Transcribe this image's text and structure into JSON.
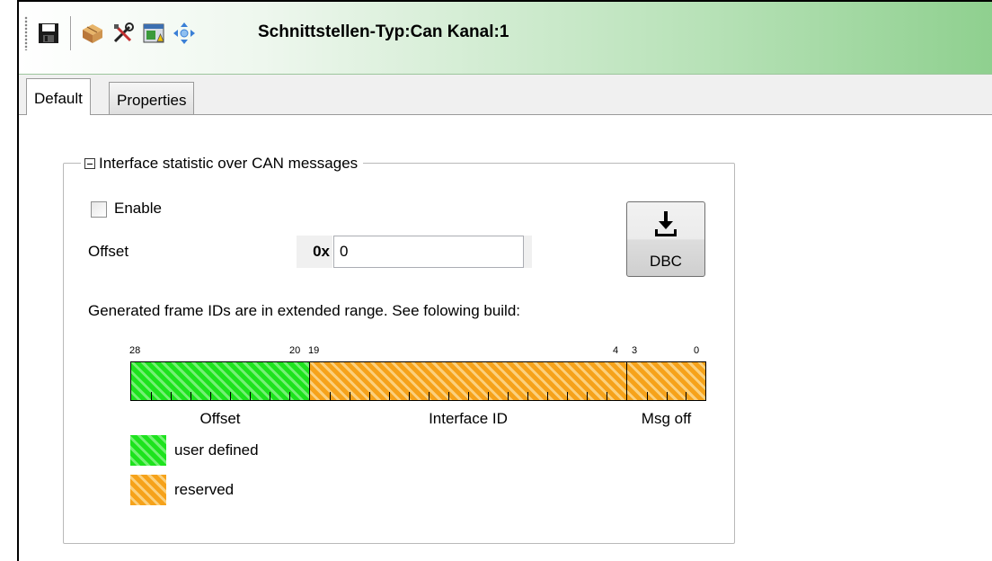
{
  "toolbar": {
    "title": "Schnittstellen-Typ:Can Kanal:1",
    "icons": [
      "save-icon",
      "package-icon",
      "tools-icon",
      "warning-window-icon",
      "move-arrows-icon"
    ]
  },
  "tabs": [
    {
      "label": "Default",
      "active": true
    },
    {
      "label": "Properties",
      "active": false
    }
  ],
  "group": {
    "title": "Interface statistic over CAN messages",
    "enable_label": "Enable",
    "enable_checked": false,
    "offset_label": "Offset",
    "hex_prefix": "0x",
    "offset_value": "0",
    "dbc_button_label": "DBC",
    "info_text": "Generated frame IDs are in extended range. See folowing build:"
  },
  "diagram": {
    "bit_labels": {
      "b28": "28",
      "b20": "20",
      "b19": "19",
      "b4": "4",
      "b3": "3",
      "b0": "0"
    },
    "segments": [
      {
        "name": "Offset",
        "high_bit": 28,
        "low_bit": 20,
        "kind": "user defined"
      },
      {
        "name": "Interface ID",
        "high_bit": 19,
        "low_bit": 4,
        "kind": "reserved"
      },
      {
        "name": "Msg off",
        "high_bit": 3,
        "low_bit": 0,
        "kind": "reserved"
      }
    ],
    "legend": {
      "user_defined": "user defined",
      "reserved": "reserved"
    },
    "colors": {
      "user_defined": "#1de31d",
      "reserved": "#f6a21a"
    }
  }
}
